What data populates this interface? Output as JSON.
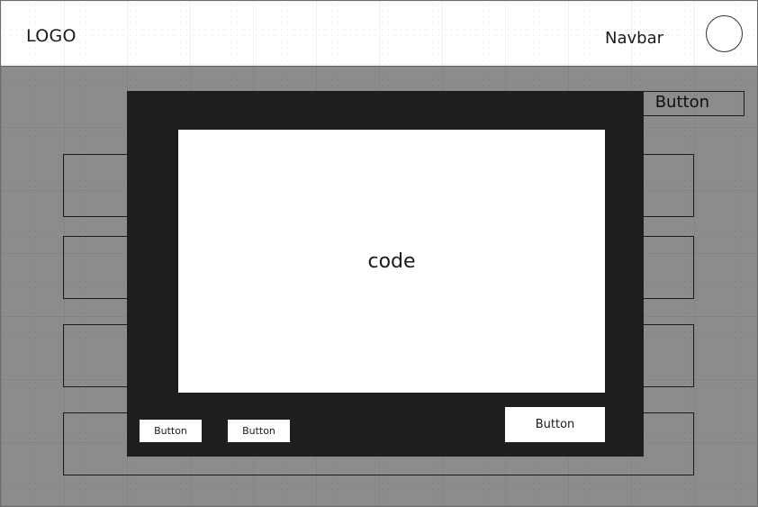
{
  "navbar": {
    "logo": "LOGO",
    "label": "Navbar"
  },
  "page": {
    "top_button_label": "Button",
    "rows": [
      {},
      {},
      {},
      {}
    ]
  },
  "modal": {
    "code_label": "code",
    "buttons": {
      "first": "Button",
      "second": "Button",
      "primary": "Button"
    }
  },
  "colors": {
    "overlay": "#8c8c8c",
    "modal_background": "#1e1e1e",
    "panel_background": "#ffffff",
    "stroke": "#333333"
  }
}
